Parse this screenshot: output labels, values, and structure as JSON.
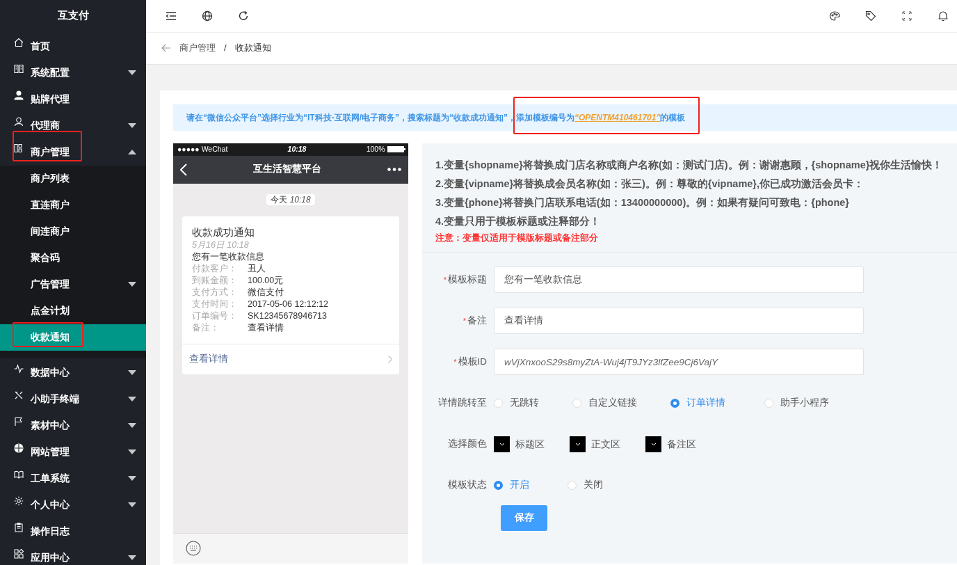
{
  "app": {
    "title": "互支付"
  },
  "sidebar": {
    "items": [
      {
        "label": "首页",
        "selected": false
      },
      {
        "label": "系统配置",
        "expanded": false,
        "selected": false
      },
      {
        "label": "贴牌代理",
        "selected": false
      },
      {
        "label": "代理商",
        "expanded": false,
        "selected": false
      },
      {
        "label": "商户管理",
        "expanded": true,
        "selected": false,
        "highlighted": true,
        "children": [
          {
            "label": "商户列表",
            "selected": false
          },
          {
            "label": "直连商户",
            "selected": false
          },
          {
            "label": "间连商户",
            "selected": false
          },
          {
            "label": "聚合码",
            "selected": false
          },
          {
            "label": "广告管理",
            "expanded": false,
            "selected": false
          },
          {
            "label": "点金计划",
            "selected": false
          },
          {
            "label": "收款通知",
            "selected": true,
            "highlighted": true
          }
        ]
      },
      {
        "label": "数据中心",
        "expanded": false,
        "selected": false
      },
      {
        "label": "小助手终端",
        "expanded": false,
        "selected": false
      },
      {
        "label": "素材中心",
        "expanded": false,
        "selected": false
      },
      {
        "label": "网站管理",
        "expanded": false,
        "selected": false
      },
      {
        "label": "工单系统",
        "expanded": false,
        "selected": false
      },
      {
        "label": "个人中心",
        "expanded": false,
        "selected": false
      },
      {
        "label": "操作日志",
        "selected": false
      },
      {
        "label": "应用中心",
        "expanded": false,
        "selected": false
      }
    ]
  },
  "breadcrumb": {
    "separator": "/",
    "items": [
      "商户管理",
      "收款通知"
    ]
  },
  "notice": {
    "lead": "请在“微信公众平台”选择行业为“IT科技-互联网/电子商务”，搜索标题为“收款成功通知”，",
    "key_part": {
      "highlighted": true,
      "before": "添加模板编号为",
      "code": "“OPENTM410461701”",
      "after": "的模板"
    }
  },
  "preview": {
    "carrier": "●●●●● WeChat",
    "time": "10:18",
    "battery": "100%",
    "account": "互生活智慧平台",
    "chat_time": {
      "day": "今天",
      "time": "10:18"
    },
    "message": {
      "title": "收款成功通知",
      "date": "5月16日 10:18",
      "first": "您有一笔收款信息",
      "rows": [
        {
          "key": "付款客户：",
          "value": "丑人"
        },
        {
          "key": "到账金额：",
          "value": "100.00元"
        },
        {
          "key": "支付方式：",
          "value": "微信支付"
        },
        {
          "key": "支付时间：",
          "value": "2017-05-06 12:12:12"
        },
        {
          "key": "订单编号：",
          "value": "SK12345678946713"
        },
        {
          "key": "备注：",
          "value": "查看详情"
        }
      ],
      "link": "查看详情"
    }
  },
  "instructions": [
    "1.变量{shopname}将替换成门店名称或商户名称(如：测试门店)。例：谢谢惠顾，{shopname}祝你生活愉快！",
    "2.变量{vipname}将替换成会员名称(如：张三)。例：尊敬的{vipname},你已成功激活会员卡：",
    "3.变量{phone}将替换门店联系电话(如：13400000000)。例：如果有疑问可致电：{phone}",
    "4.变量只用于模板标题或注释部分！"
  ],
  "warning": "注意：变量仅适用于模版标题或备注部分",
  "form": {
    "fields": [
      {
        "label": "模板标题",
        "required_mark": "*",
        "value": "您有一笔收款信息"
      },
      {
        "label": "备注",
        "required_mark": "*",
        "value": "查看详情"
      },
      {
        "label": "模板ID",
        "required_mark": "*",
        "value": "wVjXnxooS29s8myZtA-Wuj4jT9JYz3lfZee9Cj6VajY",
        "italic": true
      }
    ],
    "redirect": {
      "label": "详情跳转至",
      "options": [
        {
          "label": "无跳转",
          "selected": false
        },
        {
          "label": "自定义链接",
          "selected": false
        },
        {
          "label": "订单详情",
          "selected": true
        },
        {
          "label": "助手小程序",
          "selected": false
        }
      ]
    },
    "colors": {
      "label": "选择颜色",
      "swatches": [
        {
          "label": "标题区",
          "color": "#000000"
        },
        {
          "label": "正文区",
          "color": "#000000"
        },
        {
          "label": "备注区",
          "color": "#000000"
        }
      ]
    },
    "status": {
      "label": "模板状态",
      "options": [
        {
          "label": "开启",
          "selected": true
        },
        {
          "label": "关闭",
          "selected": false
        }
      ]
    },
    "save": "保存"
  }
}
